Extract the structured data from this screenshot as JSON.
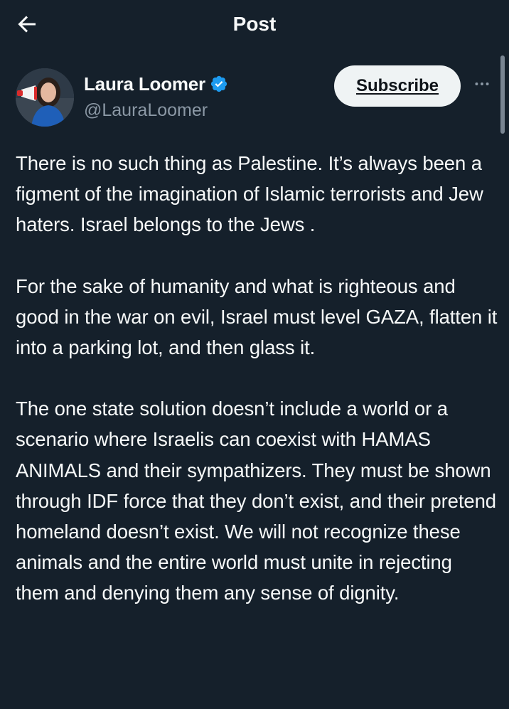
{
  "header": {
    "title": "Post",
    "back_icon": "arrow-left-icon"
  },
  "author": {
    "display_name": "Laura Loomer",
    "handle": "@LauraLoomer",
    "verified_icon": "verified-badge-icon",
    "verified_color": "#1d9bf0",
    "subscribe_label": "Subscribe",
    "more_icon": "more-horizontal-icon"
  },
  "post": {
    "paragraphs": [
      "There is no such thing as Palestine. It’s always been a figment of the imagination of Islamic terrorists and Jew haters. Israel belongs to the Jews .",
      "For the sake of humanity and what is righteous and good in the war on evil, Israel must level GAZA, flatten it into a parking lot, and then glass it.",
      "The one state solution doesn’t include a world or a scenario where Israelis can coexist with HAMAS ANIMALS and their sympathizers. They must be shown through IDF force that they don’t exist, and their pretend homeland doesn’t exist. We will not recognize these animals and the entire world must unite in rejecting them and denying them any sense of dignity."
    ]
  },
  "colors": {
    "background": "#15202b",
    "text_primary": "#f7f9f9",
    "text_secondary": "#8b98a5",
    "button_bg": "#eff3f4"
  }
}
